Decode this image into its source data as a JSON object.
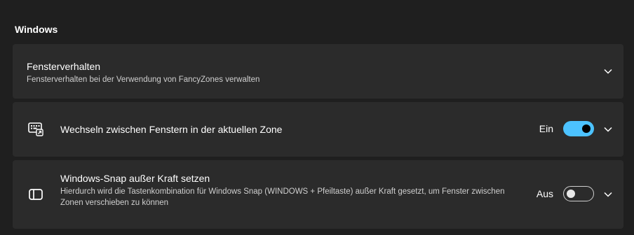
{
  "section": {
    "title": "Windows"
  },
  "cards": [
    {
      "title": "Fensterverhalten",
      "description": "Fensterverhalten bei der Verwendung von FancyZones verwalten",
      "icon": "chevron-down-icon"
    },
    {
      "title": "Wechseln zwischen Fenstern in der aktuellen Zone",
      "icon": "keyboard-shortcut-icon",
      "toggle": {
        "label": "Ein",
        "state": "on"
      }
    },
    {
      "title": "Windows-Snap außer Kraft setzen",
      "description": "Hierdurch wird die Tastenkombination für Windows Snap (WINDOWS + Pfeiltaste) außer Kraft gesetzt, um Fenster zwischen Zonen verschieben zu können",
      "icon": "window-panel-icon",
      "toggle": {
        "label": "Aus",
        "state": "off"
      }
    }
  ],
  "colors": {
    "background": "#1f1f1f",
    "card": "#2b2b2b",
    "accent": "#4cc2ff"
  }
}
